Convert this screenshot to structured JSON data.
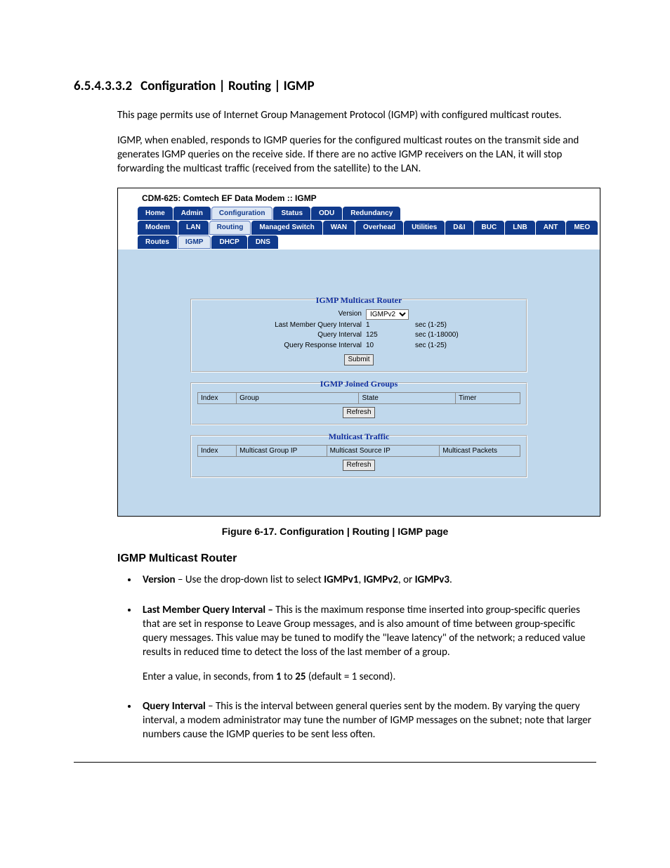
{
  "heading": {
    "num": "6.5.4.3.3.2",
    "title": "Configuration | Routing | IGMP"
  },
  "p1": "This page permits use of Internet Group Management Protocol (IGMP) with configured multicast routes.",
  "p2": "IGMP, when enabled, responds to IGMP queries for the configured multicast routes on the transmit side and generates IGMP queries on the receive side. If there are no active IGMP receivers on the LAN, it will stop forwarding the multicast traffic (received from the satellite) to the LAN.",
  "ss": {
    "window_title": "CDM-625: Comtech EF Data Modem :: IGMP",
    "nav1": [
      "Home",
      "Admin",
      "Configuration",
      "Status",
      "ODU",
      "Redundancy"
    ],
    "nav1_active": "Configuration",
    "nav2": [
      "Modem",
      "LAN",
      "Routing",
      "Managed Switch",
      "WAN",
      "Overhead",
      "Utilities",
      "D&I",
      "BUC",
      "LNB",
      "ANT",
      "MEO"
    ],
    "nav2_active": "Routing",
    "nav3": [
      "Routes",
      "IGMP",
      "DHCP",
      "DNS"
    ],
    "nav3_active": "IGMP",
    "panel1": {
      "title": "IGMP Multicast Router",
      "version_label": "Version",
      "version_value": "IGMPv2",
      "lmq_label": "Last Member Query Interval",
      "lmq_value": "1",
      "lmq_unit": "sec (1-25)",
      "qi_label": "Query Interval",
      "qi_value": "125",
      "qi_unit": "sec (1-18000)",
      "qri_label": "Query Response Interval",
      "qri_value": "10",
      "qri_unit": "sec (1-25)",
      "submit": "Submit"
    },
    "panel2": {
      "title": "IGMP Joined Groups",
      "cols": [
        "Index",
        "Group",
        "State",
        "Timer"
      ],
      "refresh": "Refresh"
    },
    "panel3": {
      "title": "Multicast Traffic",
      "cols": [
        "Index",
        "Multicast Group IP",
        "Multicast Source IP",
        "Multicast Packets"
      ],
      "refresh": "Refresh"
    }
  },
  "figcaption": "Figure 6-17. Configuration | Routing | IGMP page",
  "sec_title": "IGMP Multicast Router",
  "bullets": {
    "b1_strong1": "Version",
    "b1_rest1": " – Use the drop-down list to select ",
    "b1_strong2": "IGMPv1",
    "b1_sep1": ", ",
    "b1_strong3": "IGMPv2",
    "b1_sep2": ", or ",
    "b1_strong4": "IGMPv3",
    "b1_end": ".",
    "b2_strong": "Last Member Query Interval – ",
    "b2_rest": "This is the maximum response time inserted into group-specific queries that are set in response to Leave Group messages, and is also amount of time between group-specific query messages. This value may be tuned to modify the \"leave latency\" of the network; a reduced value results in reduced time to detect the loss of the last member of a group.",
    "b2_p2a": "Enter a value, in seconds, from ",
    "b2_p2b": "1",
    "b2_p2c": " to ",
    "b2_p2d": "25",
    "b2_p2e": " (default = 1 second).",
    "b3_strong": "Query Interval",
    "b3_rest": " – This is the interval between general queries sent by the modem. By varying the query interval, a modem administrator may tune the number of IGMP messages on the subnet; note that larger numbers cause the IGMP queries to be sent less often."
  }
}
